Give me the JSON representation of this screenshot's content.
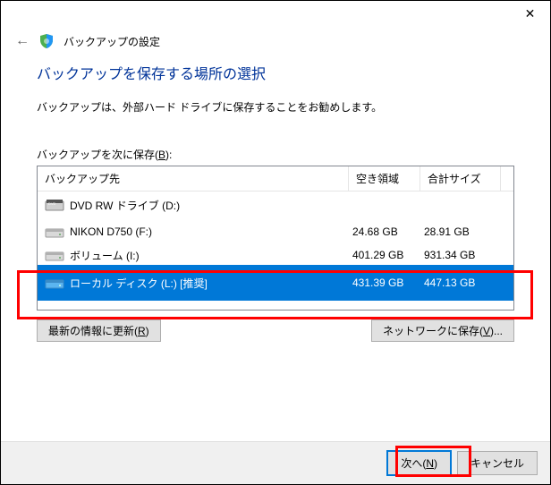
{
  "window": {
    "title": "バックアップの設定"
  },
  "heading": "バックアップを保存する場所の選択",
  "description": "バックアップは、外部ハード ドライブに保存することをお勧めします。",
  "saveLabel": "バックアップを次に保存(B):",
  "columns": {
    "dest": "バックアップ先",
    "free": "空き領域",
    "total": "合計サイズ"
  },
  "drives": [
    {
      "name": "DVD RW ドライブ (D:)",
      "free": "",
      "total": "",
      "type": "dvd"
    },
    {
      "name": "NIKON D750 (F:)",
      "free": "24.68 GB",
      "total": "28.91 GB",
      "type": "hdd"
    },
    {
      "name": "ボリューム (I:)",
      "free": "401.29 GB",
      "total": "931.34 GB",
      "type": "hdd"
    },
    {
      "name": "ローカル ディスク (L:) [推奨]",
      "free": "431.39 GB",
      "total": "447.13 GB",
      "type": "hdd"
    }
  ],
  "buttons": {
    "refresh": "最新の情報に更新(R)",
    "network": "ネットワークに保存(V)...",
    "next": "次へ(N)",
    "cancel": "キャンセル"
  }
}
